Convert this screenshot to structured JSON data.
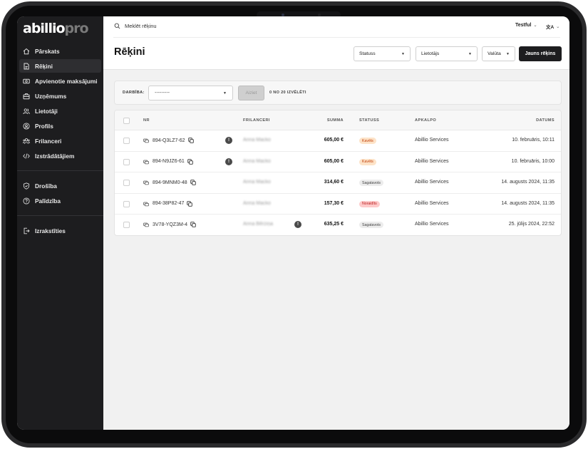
{
  "sidebar": {
    "logo_main": "abillio",
    "logo_suffix": "pro",
    "items": [
      {
        "label": "Pārskats",
        "icon": "home-icon"
      },
      {
        "label": "Rēķini",
        "icon": "document-icon"
      },
      {
        "label": "Apvienotie maksājumi",
        "icon": "banknote-icon"
      },
      {
        "label": "Uzņēmums",
        "icon": "briefcase-icon"
      },
      {
        "label": "Lietotāji",
        "icon": "users-icon"
      },
      {
        "label": "Profils",
        "icon": "user-circle-icon"
      },
      {
        "label": "Frilanceri",
        "icon": "people-icon"
      },
      {
        "label": "Izstrādātājiem",
        "icon": "code-icon"
      },
      {
        "label": "Drošība",
        "icon": "shield-icon"
      },
      {
        "label": "Palīdzība",
        "icon": "help-icon"
      },
      {
        "label": "Izrakstīties",
        "icon": "logout-icon"
      }
    ]
  },
  "header": {
    "search_placeholder": "Meklēt rēķinu",
    "tenant": "Testful",
    "language_icon": "translate-icon",
    "title": "Rēķini",
    "filters": {
      "status": "Statuss",
      "user": "Lietotājs",
      "currency": "Valūta"
    },
    "new_invoice": "Jauns rēķins"
  },
  "bulk_action": {
    "label": "DARBĪBA:",
    "select_value": "---------",
    "apply": "Aiziet",
    "selected": "0 no 20 izvēlēti"
  },
  "table": {
    "columns": {
      "nr": "NR",
      "freelancers": "FRILANCERI",
      "amount": "SUMMA",
      "status": "STATUSS",
      "service": "APKALPO",
      "date": "DATUMS"
    },
    "rows": [
      {
        "id": "894-Q3LZ7-62",
        "freelancer": "Anna Macko",
        "warning": true,
        "amount": "605,00 €",
        "status": "Kavēts",
        "status_color": "#fde3c8",
        "status_text_color": "#c2410c",
        "service": "Abillio Services",
        "date": "10. februāris, 10:11"
      },
      {
        "id": "894-N9JZ6-61",
        "freelancer": "Anna Macko",
        "warning": true,
        "amount": "605,00 €",
        "status": "Kavēts",
        "status_color": "#fde3c8",
        "status_text_color": "#c2410c",
        "service": "Abillio Services",
        "date": "10. februāris, 10:00"
      },
      {
        "id": "894-9MNM0-48",
        "freelancer": "Anna Macko",
        "warning": false,
        "amount": "314,60 €",
        "status": "Sagatavots",
        "status_color": "#ececec",
        "status_text_color": "#444444",
        "service": "Abillio Services",
        "date": "14. augusts 2024, 11:35"
      },
      {
        "id": "894-38P82-47",
        "freelancer": "Anna Macko",
        "warning": false,
        "amount": "157,30 €",
        "status": "Noraidīts",
        "status_color": "#fecaca",
        "status_text_color": "#b91c1c",
        "service": "Abillio Services",
        "date": "14. augusts 2024, 11:35"
      },
      {
        "id": "3V78-YQZ3M-4",
        "freelancer": "Anna Bērziņa",
        "warning": true,
        "amount": "635,25 €",
        "status": "Sagatavots",
        "status_color": "#ececec",
        "status_text_color": "#444444",
        "service": "Abillio Services",
        "date": "25. jūlijs 2024, 22:52"
      }
    ]
  }
}
